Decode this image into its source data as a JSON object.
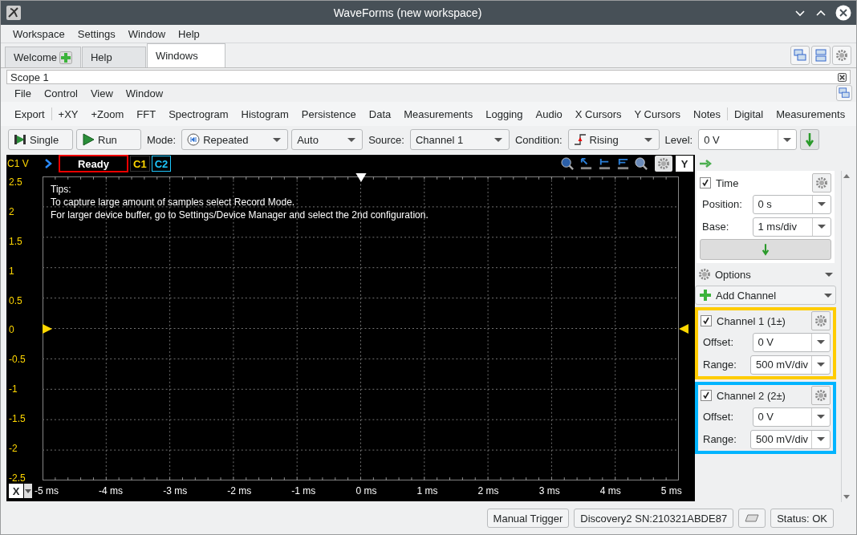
{
  "window": {
    "title": "WaveForms (new workspace)"
  },
  "menu": [
    "Workspace",
    "Settings",
    "Window",
    "Help"
  ],
  "tabs": [
    {
      "label": "Welcome",
      "selected": false,
      "kind": "add"
    },
    {
      "label": "Help",
      "selected": false,
      "kind": "plain"
    },
    {
      "label": "Windows",
      "selected": true,
      "kind": "plain"
    }
  ],
  "scope": {
    "title": "Scope 1",
    "menu": [
      "File",
      "Control",
      "View",
      "Window"
    ]
  },
  "toolbar": [
    [
      "Export"
    ],
    [
      "+XY",
      "+Zoom",
      "FFT",
      "Spectrogram",
      "Histogram",
      "Persistence",
      "Data",
      "Measurements",
      "Logging",
      "Audio",
      "X Cursors",
      "Y Cursors",
      "Notes"
    ],
    [
      "Digital",
      "Measurements"
    ]
  ],
  "controls": {
    "single": "Single",
    "run": "Run",
    "mode_label": "Mode:",
    "mode": "Repeated",
    "mode_type": "Auto",
    "source_label": "Source:",
    "source": "Channel 1",
    "condition_label": "Condition:",
    "condition": "Rising",
    "level_label": "Level:",
    "level": "0 V"
  },
  "plot": {
    "y_unit": "C1 V",
    "status": "Ready",
    "channel_tags": [
      {
        "label": "C1",
        "color": "#ffd700"
      },
      {
        "label": "C2",
        "color": "#1ec8ff"
      }
    ],
    "y_button": "Y",
    "x_button": "X",
    "tips": [
      "Tips:",
      "To capture large amount of samples select Record Mode.",
      "For larger device buffer, go to Settings/Device Manager and select the 2nd configuration."
    ],
    "y_ticks": [
      "2.5",
      "2",
      "1.5",
      "1",
      "0.5",
      "0",
      "-0.5",
      "-1",
      "-1.5",
      "-2",
      "-2.5"
    ],
    "x_ticks": [
      "-5 ms",
      "-4 ms",
      "-3 ms",
      "-2 ms",
      "-1 ms",
      "0 ms",
      "1 ms",
      "2 ms",
      "3 ms",
      "4 ms",
      "5 ms"
    ]
  },
  "panel": {
    "time": {
      "label": "Time",
      "checked": true,
      "fields": [
        {
          "label": "Position:",
          "value": "0 s"
        },
        {
          "label": "Base:",
          "value": "1 ms/div"
        }
      ]
    },
    "options": "Options",
    "add_channel": "Add Channel",
    "channels": [
      {
        "name": "Channel 1 (1±)",
        "checked": true,
        "color": "#ffcc00",
        "fields": [
          {
            "label": "Offset:",
            "value": "0 V"
          },
          {
            "label": "Range:",
            "value": "500 mV/div"
          }
        ]
      },
      {
        "name": "Channel 2 (2±)",
        "checked": true,
        "color": "#00b4ff",
        "fields": [
          {
            "label": "Offset:",
            "value": "0 V"
          },
          {
            "label": "Range:",
            "value": "500 mV/div"
          }
        ]
      }
    ]
  },
  "status_bar": {
    "manual_trigger": "Manual Trigger",
    "device": "Discovery2 SN:210321ABDE87",
    "status": "Status: OK"
  }
}
